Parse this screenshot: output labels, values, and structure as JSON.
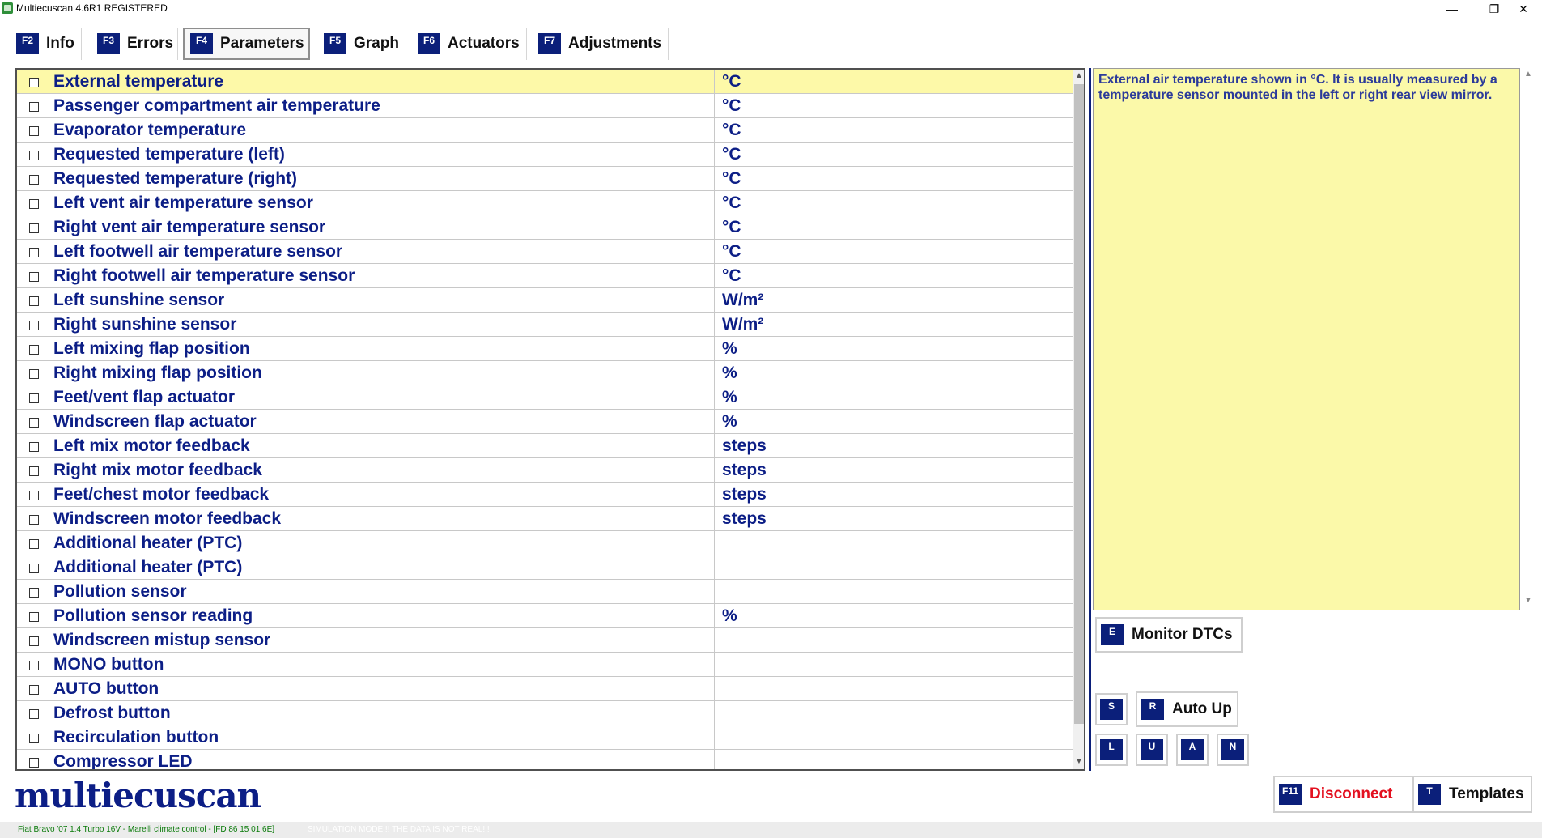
{
  "window": {
    "title": "Multiecuscan 4.6R1 REGISTERED",
    "controls": {
      "minimize": "—",
      "restore": "❐",
      "close": "✕"
    }
  },
  "tabs": [
    {
      "key": "F2",
      "label": "Info"
    },
    {
      "key": "F3",
      "label": "Errors"
    },
    {
      "key": "F4",
      "label": "Parameters",
      "active": true
    },
    {
      "key": "F5",
      "label": "Graph"
    },
    {
      "key": "F6",
      "label": "Actuators"
    },
    {
      "key": "F7",
      "label": "Adjustments"
    }
  ],
  "parameters": [
    {
      "name": "External temperature",
      "unit": "°C",
      "selected": true
    },
    {
      "name": "Passenger compartment air temperature",
      "unit": "°C"
    },
    {
      "name": "Evaporator temperature",
      "unit": "°C"
    },
    {
      "name": "Requested temperature (left)",
      "unit": "°C"
    },
    {
      "name": "Requested temperature (right)",
      "unit": "°C"
    },
    {
      "name": "Left vent air temperature sensor",
      "unit": "°C"
    },
    {
      "name": "Right vent air temperature sensor",
      "unit": "°C"
    },
    {
      "name": "Left footwell air temperature sensor",
      "unit": "°C"
    },
    {
      "name": "Right footwell air temperature sensor",
      "unit": "°C"
    },
    {
      "name": "Left sunshine sensor",
      "unit": "W/m²"
    },
    {
      "name": "Right sunshine sensor",
      "unit": "W/m²"
    },
    {
      "name": "Left mixing flap position",
      "unit": "%"
    },
    {
      "name": "Right mixing flap position",
      "unit": "%"
    },
    {
      "name": "Feet/vent flap actuator",
      "unit": "%"
    },
    {
      "name": "Windscreen flap actuator",
      "unit": "%"
    },
    {
      "name": "Left mix motor feedback",
      "unit": "steps"
    },
    {
      "name": "Right mix motor feedback",
      "unit": "steps"
    },
    {
      "name": "Feet/chest motor feedback",
      "unit": "steps"
    },
    {
      "name": "Windscreen motor feedback",
      "unit": "steps"
    },
    {
      "name": "Additional heater (PTC)",
      "unit": ""
    },
    {
      "name": "Additional heater (PTC)",
      "unit": ""
    },
    {
      "name": "Pollution sensor",
      "unit": ""
    },
    {
      "name": "Pollution sensor reading",
      "unit": "%"
    },
    {
      "name": "Windscreen mistup sensor",
      "unit": ""
    },
    {
      "name": "MONO button",
      "unit": ""
    },
    {
      "name": "AUTO button",
      "unit": ""
    },
    {
      "name": "Defrost button",
      "unit": ""
    },
    {
      "name": "Recirculation button",
      "unit": ""
    },
    {
      "name": "Compressor LED",
      "unit": ""
    }
  ],
  "description": "External air temperature shown in °C. It is usually measured by a temperature sensor mounted in the left or right rear view mirror.",
  "buttons": {
    "monitor_dtcs": {
      "key": "E",
      "label": "Monitor DTCs"
    },
    "s": {
      "key": "S"
    },
    "auto_up": {
      "key": "R",
      "label": "Auto Up"
    },
    "l": {
      "key": "L"
    },
    "u": {
      "key": "U"
    },
    "a": {
      "key": "A"
    },
    "n": {
      "key": "N"
    },
    "disconnect": {
      "key": "F11",
      "label": "Disconnect"
    },
    "templates": {
      "key": "T",
      "label": "Templates"
    }
  },
  "logo": "multiecuscan",
  "status": {
    "vehicle": "Fiat Bravo '07 1.4 Turbo 16V - Marelli climate control - [FD 86 15 01 6E]",
    "simulation": "SIMULATION MODE!!! THE DATA IS NOT REAL!!!"
  },
  "colors": {
    "accent_navy": "#0b1f7a",
    "text_blue": "#0c1e86",
    "selected_row": "#fdf9a8",
    "description_bg": "#fbf9a9",
    "disconnect_red": "#e3101f",
    "status_green": "#0a7a0a"
  },
  "icons": {
    "app": "app-icon",
    "checkbox": "checkbox-icon",
    "scroll_up": "scroll-up-arrow-icon",
    "scroll_down": "scroll-down-arrow-icon"
  }
}
